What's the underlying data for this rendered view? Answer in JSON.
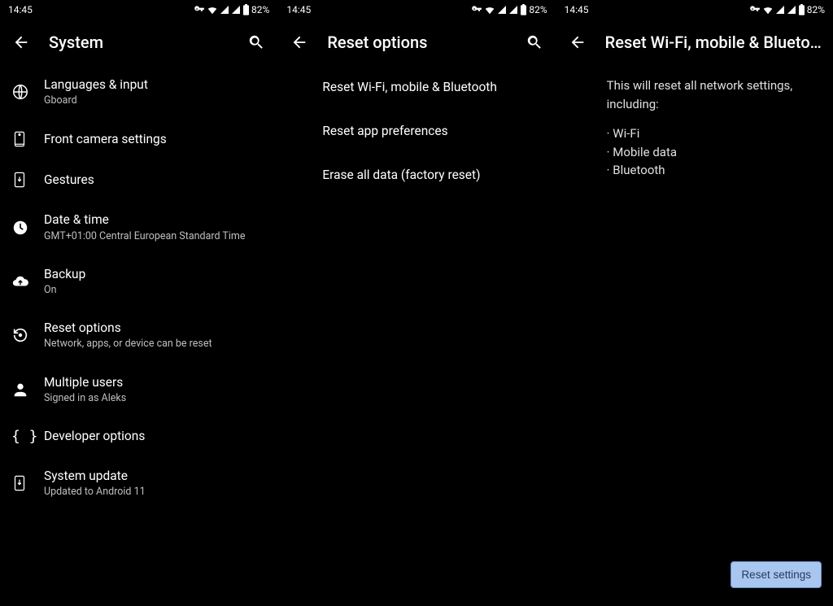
{
  "status": {
    "time": "14:45",
    "battery": "82%"
  },
  "panel1": {
    "title": "System",
    "items": [
      {
        "title": "Languages & input",
        "subtitle": "Gboard"
      },
      {
        "title": "Front camera settings",
        "subtitle": ""
      },
      {
        "title": "Gestures",
        "subtitle": ""
      },
      {
        "title": "Date & time",
        "subtitle": "GMT+01:00 Central European Standard Time"
      },
      {
        "title": "Backup",
        "subtitle": "On"
      },
      {
        "title": "Reset options",
        "subtitle": "Network, apps, or device can be reset"
      },
      {
        "title": "Multiple users",
        "subtitle": "Signed in as Aleks"
      },
      {
        "title": "Developer options",
        "subtitle": ""
      },
      {
        "title": "System update",
        "subtitle": "Updated to Android 11"
      }
    ]
  },
  "panel2": {
    "title": "Reset options",
    "items": [
      "Reset Wi-Fi, mobile & Bluetooth",
      "Reset app preferences",
      "Erase all data (factory reset)"
    ]
  },
  "panel3": {
    "title": "Reset Wi-Fi, mobile & Blueto…",
    "description": "This will reset all network settings, including:",
    "bullets": [
      "Wi-Fi",
      "Mobile data",
      "Bluetooth"
    ],
    "button": "Reset settings"
  }
}
